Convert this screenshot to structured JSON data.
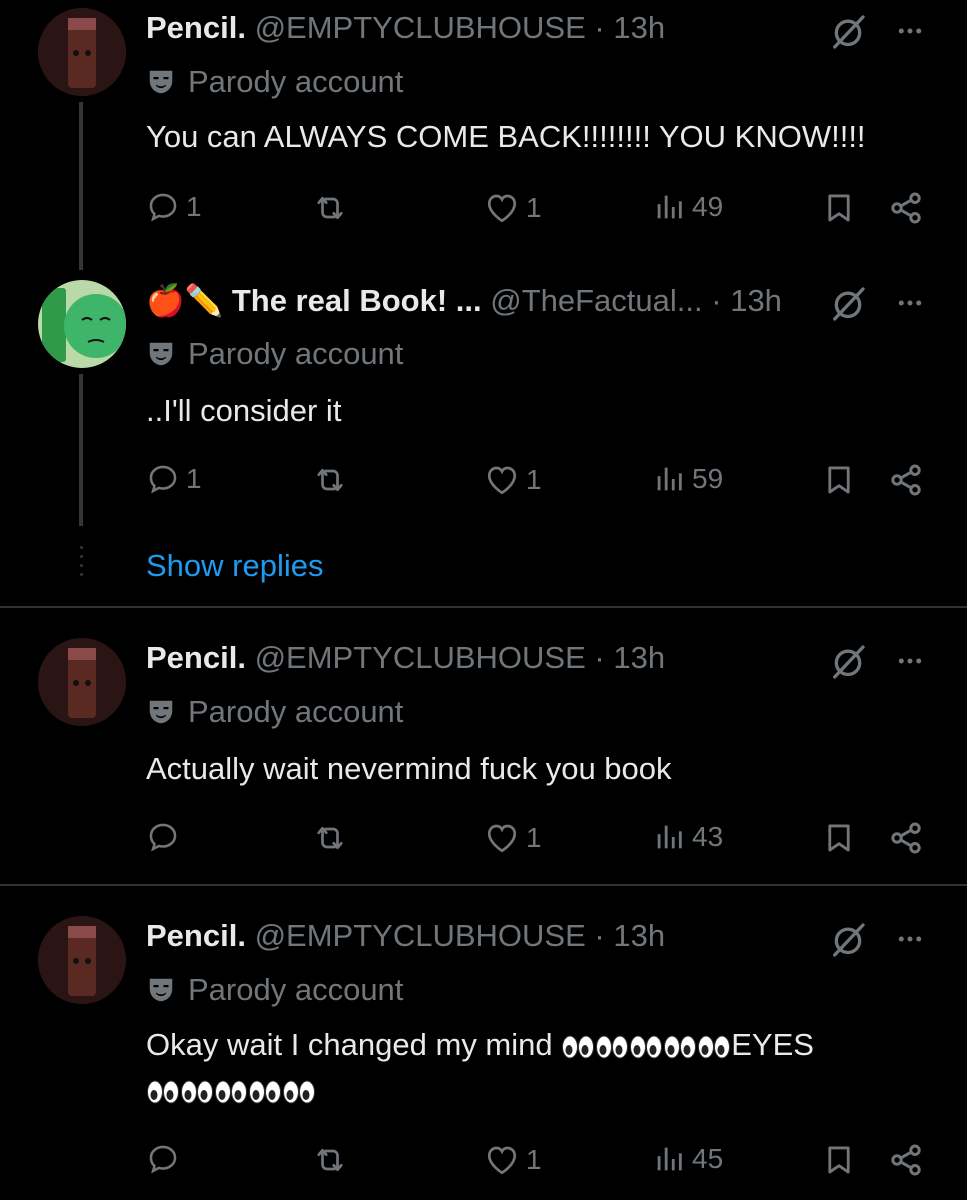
{
  "tweets": [
    {
      "name": "Pencil.",
      "handle": "@EMPTYCLUBHOUSE",
      "sep": "·",
      "time": "13h",
      "parody": "Parody account",
      "text": "You can ALWAYS COME BACK!!!!!!!! YOU KNOW!!!!",
      "replies": "1",
      "reposts": "",
      "likes": "1",
      "views": "49"
    },
    {
      "name_emoji": "🍎✏️",
      "name": "The real Book! ...",
      "handle": "@TheFactual...",
      "sep": "·",
      "time": "13h",
      "parody": "Parody account",
      "text": "..I'll consider it",
      "replies": "1",
      "reposts": "",
      "likes": "1",
      "views": "59"
    },
    {
      "name": "Pencil.",
      "handle": "@EMPTYCLUBHOUSE",
      "sep": "·",
      "time": "13h",
      "parody": "Parody account",
      "text": "Actually wait nevermind fuck you book",
      "replies": "",
      "reposts": "",
      "likes": "1",
      "views": "43"
    },
    {
      "name": "Pencil.",
      "handle": "@EMPTYCLUBHOUSE",
      "sep": "·",
      "time": "13h",
      "parody": "Parody account",
      "text_line1": "Okay wait I changed my mind",
      "text_mid": "EYES",
      "replies": "",
      "reposts": "",
      "likes": "1",
      "views": "45"
    }
  ],
  "show_replies": "Show replies",
  "icons": [
    "grok-icon",
    "more-icon",
    "mask-icon",
    "reply-icon",
    "repost-icon",
    "like-icon",
    "views-icon",
    "bookmark-icon",
    "share-icon",
    "eyes-emoji"
  ],
  "colors": {
    "background": "#000000",
    "text": "#e7e9ea",
    "muted": "#71767b",
    "link": "#1d9bf0",
    "divider": "#2f3336"
  }
}
